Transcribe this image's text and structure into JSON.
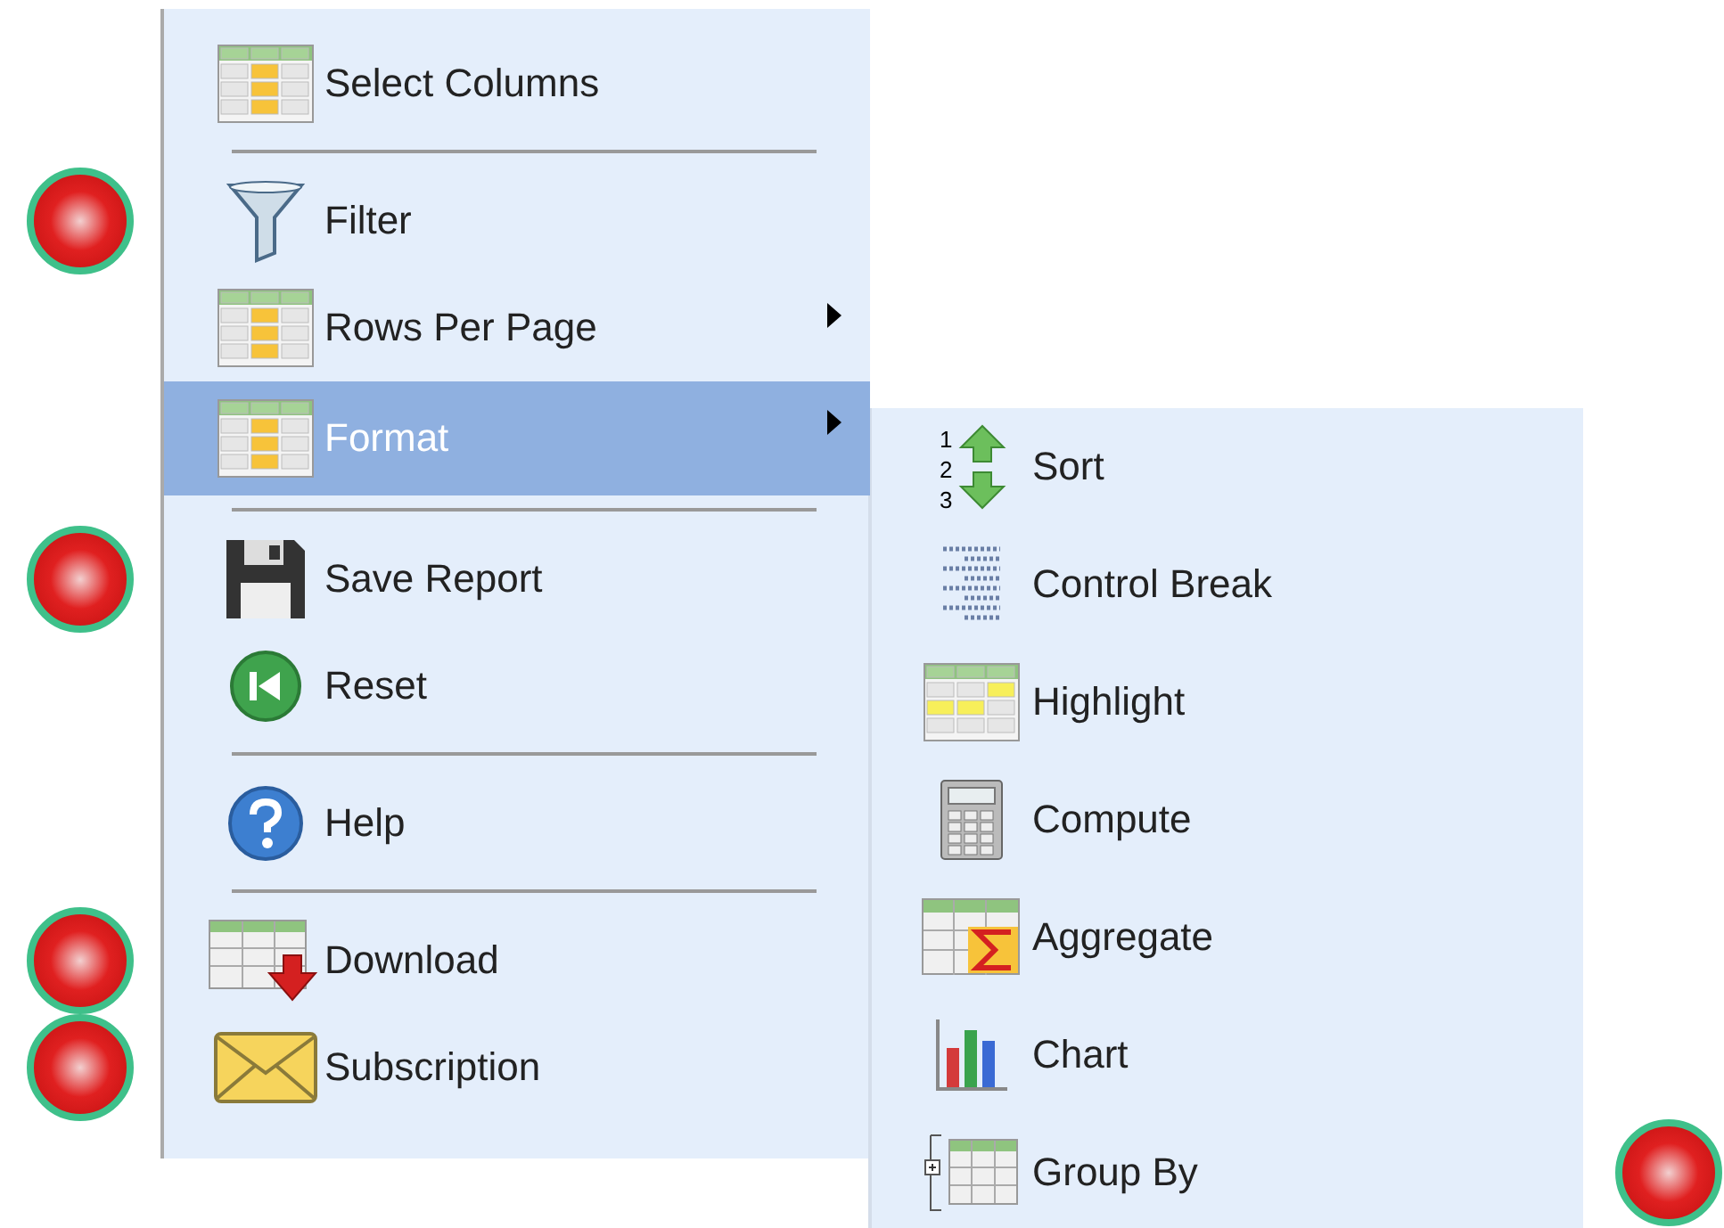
{
  "menu": {
    "items": [
      {
        "kind": "item",
        "label": "Select Columns",
        "selected": false,
        "has_submenu": false,
        "marked": false
      },
      {
        "kind": "separator"
      },
      {
        "kind": "item",
        "label": "Filter",
        "selected": false,
        "has_submenu": false,
        "marked": true
      },
      {
        "kind": "item",
        "label": "Rows Per Page",
        "selected": false,
        "has_submenu": true,
        "marked": false
      },
      {
        "kind": "item",
        "label": "Format",
        "selected": true,
        "has_submenu": true,
        "marked": false
      },
      {
        "kind": "separator"
      },
      {
        "kind": "item",
        "label": "Save Report",
        "selected": false,
        "has_submenu": false,
        "marked": true
      },
      {
        "kind": "item",
        "label": "Reset",
        "selected": false,
        "has_submenu": false,
        "marked": false
      },
      {
        "kind": "separator"
      },
      {
        "kind": "item",
        "label": "Help",
        "selected": false,
        "has_submenu": false,
        "marked": false
      },
      {
        "kind": "separator"
      },
      {
        "kind": "item",
        "label": "Download",
        "selected": false,
        "has_submenu": false,
        "marked": true
      },
      {
        "kind": "item",
        "label": "Subscription",
        "selected": false,
        "has_submenu": false,
        "marked": true
      }
    ]
  },
  "submenu": {
    "items": [
      {
        "label": "Sort",
        "marked": false,
        "icon_digits": [
          "1",
          "2",
          "3"
        ]
      },
      {
        "label": "Control Break",
        "marked": false
      },
      {
        "label": "Highlight",
        "marked": false
      },
      {
        "label": "Compute",
        "marked": false
      },
      {
        "label": "Aggregate",
        "marked": false
      },
      {
        "label": "Chart",
        "marked": false
      },
      {
        "label": "Group By",
        "marked": true
      }
    ]
  }
}
